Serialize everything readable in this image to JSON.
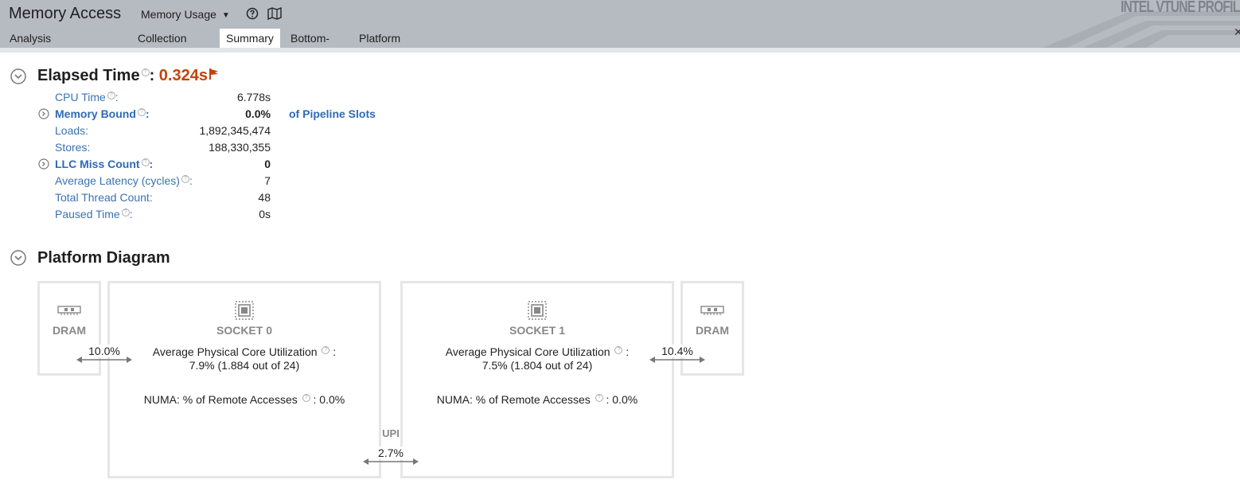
{
  "header": {
    "title": "Memory Access",
    "analysis_type": "Memory Usage",
    "brand": "INTEL VTUNE PROFILER",
    "tabs": [
      {
        "label": "Analysis Configuration"
      },
      {
        "label": "Collection Log"
      },
      {
        "label": "Summary",
        "active": true
      },
      {
        "label": "Bottom-up"
      },
      {
        "label": "Platform"
      }
    ]
  },
  "elapsed": {
    "label": "Elapsed Time",
    "value": "0.324s",
    "metrics": [
      {
        "label": "CPU Time",
        "value": "6.778s"
      },
      {
        "label": "Memory Bound",
        "value": "0.0%",
        "suffix": "of Pipeline Slots"
      },
      {
        "label": "Loads:",
        "value": "1,892,345,474"
      },
      {
        "label": "Stores:",
        "value": "188,330,355"
      },
      {
        "label": "LLC Miss Count",
        "value": "0"
      },
      {
        "label": "Average Latency (cycles)",
        "value": "7"
      },
      {
        "label": "Total Thread Count:",
        "value": "48"
      },
      {
        "label": "Paused Time",
        "value": "0s"
      }
    ]
  },
  "platform": {
    "title": "Platform Diagram",
    "dram_label": "DRAM",
    "sockets": [
      {
        "name": "SOCKET 0",
        "util_label": "Average Physical Core Utilization",
        "util_value": "7.9% (1.884 out of 24)",
        "numa_label": "NUMA: % of Remote Accesses",
        "numa_value": ": 0.0%",
        "dram_link": "10.0%"
      },
      {
        "name": "SOCKET 1",
        "util_label": "Average Physical Core Utilization",
        "util_value": "7.5% (1.804 out of 24)",
        "numa_label": "NUMA: % of Remote Accesses",
        "numa_value": ": 0.0%",
        "dram_link": "10.4%"
      }
    ],
    "upi_label": "UPI",
    "upi_value": "2.7%"
  },
  "colors": {
    "accent": "#c1440e",
    "link": "#2e6bb5",
    "header_bg": "#b6bac1"
  }
}
